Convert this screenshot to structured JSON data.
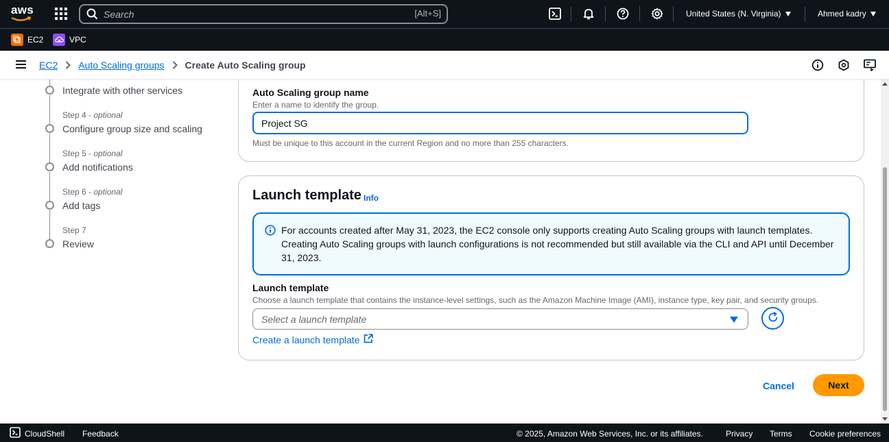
{
  "topnav": {
    "logo_text": "aws",
    "search": {
      "placeholder": "Search",
      "shortcut": "[Alt+S]"
    },
    "icons": [
      "cloudshell-icon",
      "bell-icon",
      "help-icon",
      "gear-icon"
    ],
    "region": "United States (N. Virginia)",
    "user": "Ahmed kadry"
  },
  "favorites": [
    {
      "label": "EC2",
      "color": "#ed7100"
    },
    {
      "label": "VPC",
      "color": "#8c4fff"
    }
  ],
  "breadcrumb": {
    "items": [
      "EC2",
      "Auto Scaling groups"
    ],
    "current": "Create Auto Scaling group"
  },
  "steps": [
    {
      "title": "Integrate with other services"
    },
    {
      "number": "Step 4",
      "optional": "optional",
      "title": "Configure group size and scaling"
    },
    {
      "number": "Step 5",
      "optional": "optional",
      "title": "Add notifications"
    },
    {
      "number": "Step 6",
      "optional": "optional",
      "title": "Add tags"
    },
    {
      "number": "Step 7",
      "optional": "",
      "title": "Review"
    }
  ],
  "name_card": {
    "label": "Auto Scaling group name",
    "description": "Enter a name to identify the group.",
    "value": "Project SG",
    "constraint": "Must be unique to this account in the current Region and no more than 255 characters."
  },
  "launch_card": {
    "title": "Launch template",
    "info": "Info",
    "alert": "For accounts created after May 31, 2023, the EC2 console only supports creating Auto Scaling groups with launch templates. Creating Auto Scaling groups with launch configurations is not recommended but still available via the CLI and API until December 31, 2023.",
    "field_label": "Launch template",
    "field_description": "Choose a launch template that contains the instance-level settings, such as the Amazon Machine Image (AMI), instance type, key pair, and security groups.",
    "select_placeholder": "Select a launch template",
    "create_link": "Create a launch template"
  },
  "actions": {
    "cancel": "Cancel",
    "next": "Next"
  },
  "footer": {
    "cloudshell": "CloudShell",
    "feedback": "Feedback",
    "copyright": "© 2025, Amazon Web Services, Inc. or its affiliates.",
    "privacy": "Privacy",
    "terms": "Terms",
    "cookies": "Cookie preferences"
  },
  "colors": {
    "link": "#006ce0",
    "primary": "#ff9900",
    "nav": "#0f141a"
  }
}
